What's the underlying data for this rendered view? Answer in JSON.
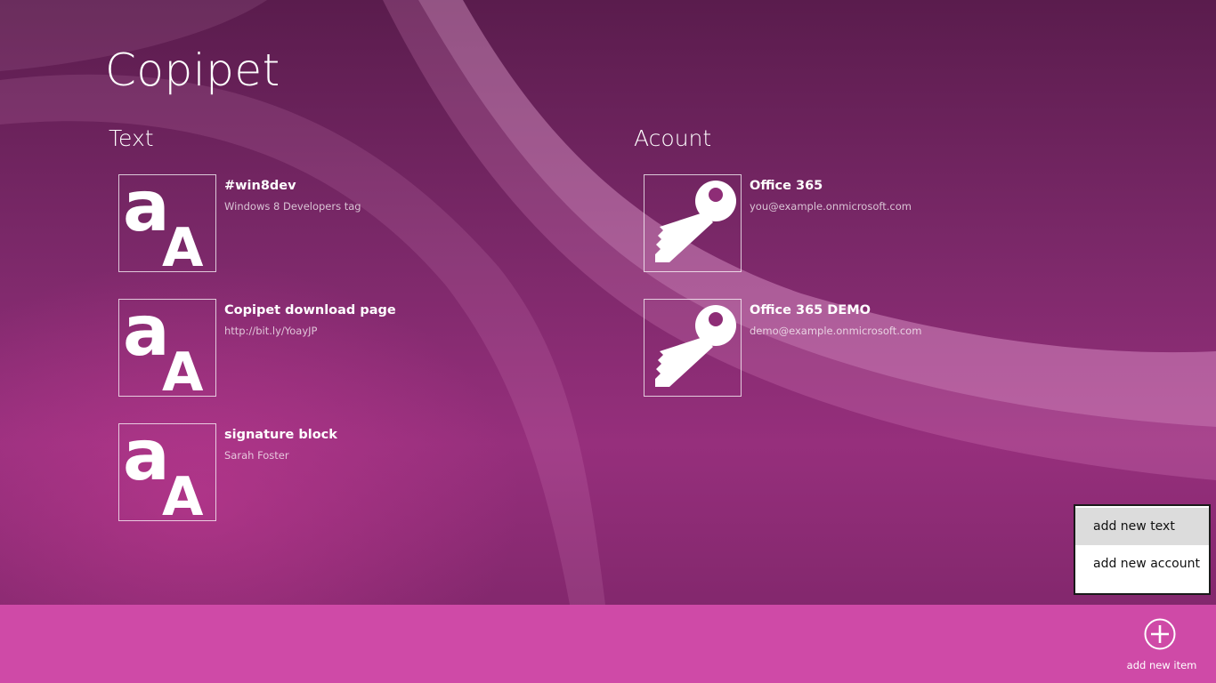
{
  "app": {
    "title": "Copipet"
  },
  "sections": {
    "text": {
      "title": "Text",
      "items": [
        {
          "title": "#win8dev",
          "subtitle": "Windows 8 Developers tag"
        },
        {
          "title": "Copipet download page",
          "subtitle": "http://bit.ly/YoayJP"
        },
        {
          "title": "signature block",
          "subtitle": "Sarah Foster"
        }
      ]
    },
    "account": {
      "title": "Acount",
      "items": [
        {
          "title": "Office 365",
          "subtitle": "you@example.onmicrosoft.com"
        },
        {
          "title": "Office 365 DEMO",
          "subtitle": "demo@example.onmicrosoft.com"
        }
      ]
    }
  },
  "icons": {
    "text_item": "text-aa-icon",
    "account_item": "key-icon",
    "add_button": "add-circle-icon"
  },
  "flyout": {
    "items": [
      {
        "label": "add new text",
        "selected": true
      },
      {
        "label": "add new account",
        "selected": false
      }
    ]
  },
  "appbar": {
    "add_label": "add new item"
  },
  "colors": {
    "background": "#7a2766",
    "appbar": "#cf4aa7",
    "text": "#ffffff",
    "flyout_selected": "#dcdcdc"
  }
}
